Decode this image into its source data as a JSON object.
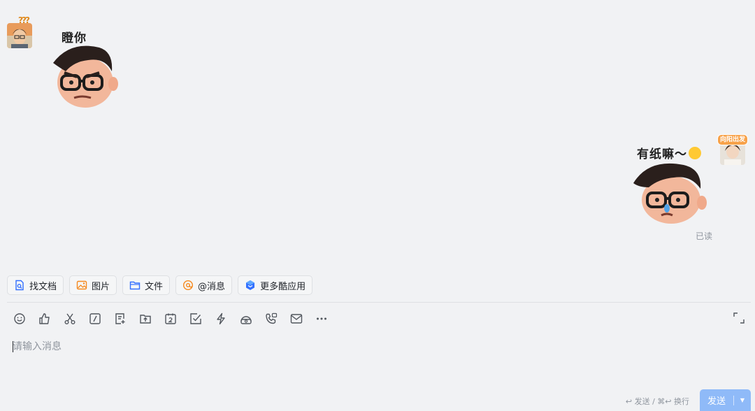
{
  "chat": {
    "incoming": {
      "sticker_text": "瞪你",
      "badge": "?"
    },
    "outgoing": {
      "sticker_text": "有纸嘛～",
      "badge": "向阳出发",
      "read_status": "已读"
    }
  },
  "quick_actions": [
    {
      "label": "找文档",
      "icon": "doc-search-icon"
    },
    {
      "label": "图片",
      "icon": "image-icon"
    },
    {
      "label": "文件",
      "icon": "folder-icon"
    },
    {
      "label": "@消息",
      "icon": "at-icon"
    },
    {
      "label": "更多酷应用",
      "icon": "apps-icon"
    }
  ],
  "toolbar": [
    "emoji-icon",
    "thumbs-up-icon",
    "scissors-icon",
    "slash-command-icon",
    "doc-add-icon",
    "upload-icon",
    "calendar-icon",
    "todo-icon",
    "lightning-icon",
    "video-meeting-icon",
    "phone-icon",
    "mail-icon",
    "more-icon"
  ],
  "composer": {
    "placeholder": "请输入消息",
    "shortcut_hint": "↩ 发送 / ⌘↩ 换行",
    "send_label": "发送"
  }
}
